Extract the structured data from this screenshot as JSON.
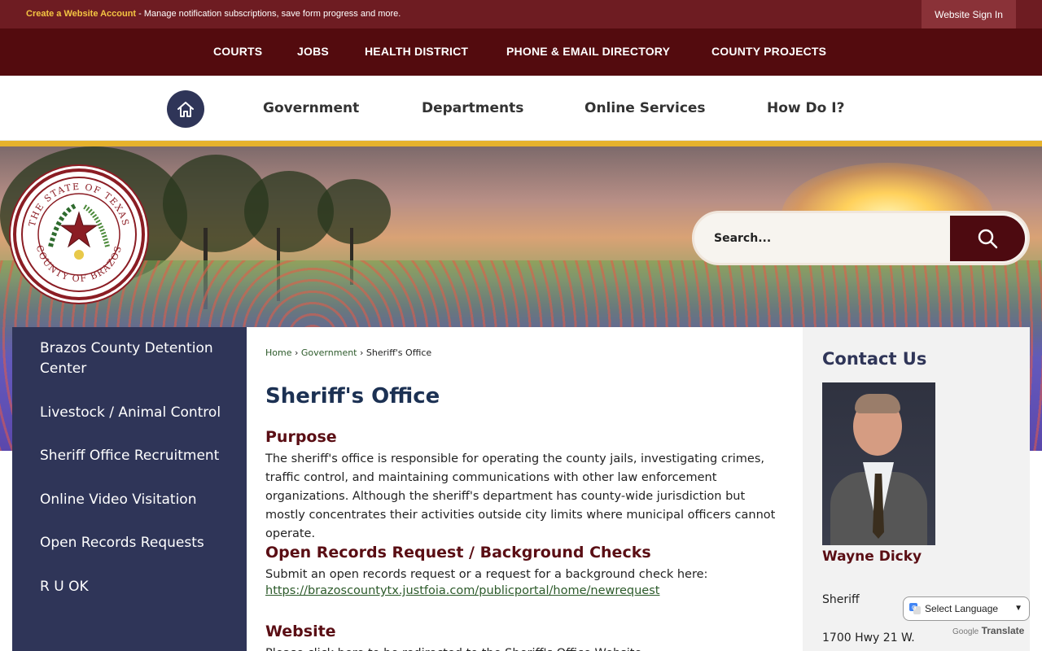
{
  "topbar": {
    "create_account": "Create a Website Account",
    "message": " - Manage notification subscriptions, save form progress and more.",
    "sign_in": "Website Sign In"
  },
  "darknav": {
    "items": [
      "COURTS",
      "JOBS",
      "HEALTH DISTRICT",
      "PHONE & EMAIL DIRECTORY",
      "COUNTY PROJECTS"
    ]
  },
  "mainnav": {
    "items": [
      "Government",
      "Departments",
      "Online Services",
      "How Do I?"
    ]
  },
  "seal": {
    "text_top": "THE STATE OF TEXAS",
    "text_bottom": "COUNTY OF BRAZOS"
  },
  "search": {
    "placeholder": "Search..."
  },
  "sidebar": {
    "links": [
      "Brazos County Detention Center",
      "Livestock / Animal Control",
      "Sheriff Office Recruitment",
      "Online Video Visitation",
      "Open Records Requests",
      "R U OK"
    ]
  },
  "breadcrumb": {
    "home": "Home",
    "government": "Government",
    "current": "Sheriff's Office",
    "sep": "›"
  },
  "content": {
    "title": "Sheriff's Office",
    "purpose_heading": "Purpose",
    "purpose_text": "The sheriff's office is responsible for operating the county jails, investigating crimes, traffic control, and maintaining communications with other law enforcement organizations. Although the sheriff's department has county-wide jurisdiction but mostly concentrates their activities outside city limits where municipal officers cannot operate.",
    "records_heading": "Open Records Request / Background Checks",
    "records_text": "Submit an open records request or a request for a background check here:",
    "records_link": "https://brazoscountytx.justfoia.com/publicportal/home/newrequest",
    "website_heading": "Website",
    "website_text": "Please click here to be redirected to the Sheriff's Office Website."
  },
  "contact": {
    "title": "Contact Us",
    "name": "Wayne Dicky",
    "role": "Sheriff",
    "address": "1700 Hwy 21 W."
  },
  "translate": {
    "select_label": "Select Language",
    "powered_by": "Google",
    "translate_word": "Translate"
  },
  "colors": {
    "maroon": "#6e1c22",
    "dark_maroon": "#530b0e",
    "navy": "#2f3558",
    "gold": "#e6b22c"
  }
}
